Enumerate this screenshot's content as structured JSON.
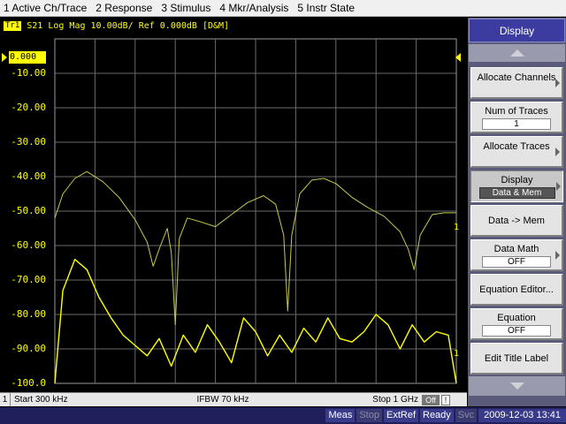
{
  "menu": {
    "items": [
      "1 Active Ch/Trace",
      "2 Response",
      "3 Stimulus",
      "4 Mkr/Analysis",
      "5 Instr State"
    ]
  },
  "trace": {
    "tag": "Tr1",
    "label": "S21 Log Mag 10.00dB/ Ref 0.000dB [D&M]",
    "ref_value": "0.000",
    "end_marker": "1"
  },
  "chart_data": {
    "type": "line",
    "xlabel": "",
    "ylabel": "",
    "x_range": [
      "300 kHz",
      "1 GHz"
    ],
    "ylim": [
      -100,
      0
    ],
    "y_ticks": [
      "0.000",
      "-10.00",
      "-20.00",
      "-30.00",
      "-40.00",
      "-50.00",
      "-60.00",
      "-70.00",
      "-80.00",
      "-90.00",
      "-100.0"
    ],
    "grid": true,
    "series": [
      {
        "color": "#c8c850",
        "x_frac": [
          0.0,
          0.02,
          0.05,
          0.08,
          0.12,
          0.16,
          0.2,
          0.23,
          0.245,
          0.26,
          0.28,
          0.29,
          0.3,
          0.31,
          0.33,
          0.36,
          0.4,
          0.44,
          0.48,
          0.52,
          0.55,
          0.57,
          0.58,
          0.59,
          0.61,
          0.64,
          0.67,
          0.7,
          0.74,
          0.78,
          0.82,
          0.86,
          0.88,
          0.895,
          0.91,
          0.94,
          0.97,
          1.0
        ],
        "values": [
          -52,
          -45,
          -40.5,
          -38.5,
          -41.5,
          -46,
          -52.5,
          -59,
          -66,
          -61,
          -55,
          -62,
          -83,
          -58,
          -52,
          -53,
          -54.5,
          -51,
          -47.5,
          -45.5,
          -48,
          -57,
          -79,
          -57,
          -45,
          -41,
          -40.5,
          -42,
          -46,
          -49,
          -51.5,
          -56,
          -61,
          -67,
          -57,
          -51,
          -50.5,
          -50.5
        ]
      },
      {
        "color": "#ffff00",
        "x_frac": [
          0.0,
          0.02,
          0.05,
          0.08,
          0.11,
          0.14,
          0.17,
          0.2,
          0.23,
          0.26,
          0.29,
          0.32,
          0.35,
          0.38,
          0.41,
          0.44,
          0.47,
          0.5,
          0.53,
          0.56,
          0.59,
          0.62,
          0.65,
          0.68,
          0.71,
          0.74,
          0.77,
          0.8,
          0.83,
          0.86,
          0.89,
          0.92,
          0.95,
          0.98,
          1.0
        ],
        "values": [
          -100,
          -73,
          -64,
          -67,
          -75,
          -81,
          -86,
          -89,
          -92,
          -87,
          -95,
          -86,
          -91,
          -83,
          -88,
          -94,
          -81,
          -85,
          -92,
          -86,
          -91,
          -84,
          -88,
          -81,
          -87,
          -88,
          -85,
          -80,
          -83,
          -90,
          -83,
          -88,
          -85,
          -86,
          -100
        ]
      }
    ]
  },
  "status": {
    "channel": "1",
    "start": "Start 300 kHz",
    "ifbw": "IFBW 70 kHz",
    "stop": "Stop 1 GHz",
    "off": "Off",
    "excl": "!"
  },
  "softkeys": {
    "title": "Display",
    "allocate_channels": "Allocate Channels",
    "num_traces": {
      "label": "Num of Traces",
      "value": "1"
    },
    "allocate_traces": "Allocate Traces",
    "display": {
      "label": "Display",
      "value": "Data & Mem"
    },
    "data_to_mem": "Data -> Mem",
    "data_math": {
      "label": "Data Math",
      "value": "OFF"
    },
    "equation_editor": "Equation Editor...",
    "equation": {
      "label": "Equation",
      "value": "OFF"
    },
    "edit_title": "Edit Title Label"
  },
  "sysbar": {
    "meas": "Meas",
    "stop": "Stop",
    "extref": "ExtRef",
    "ready": "Ready",
    "svc": "Svc",
    "datetime": "2009-12-03 13:41"
  }
}
